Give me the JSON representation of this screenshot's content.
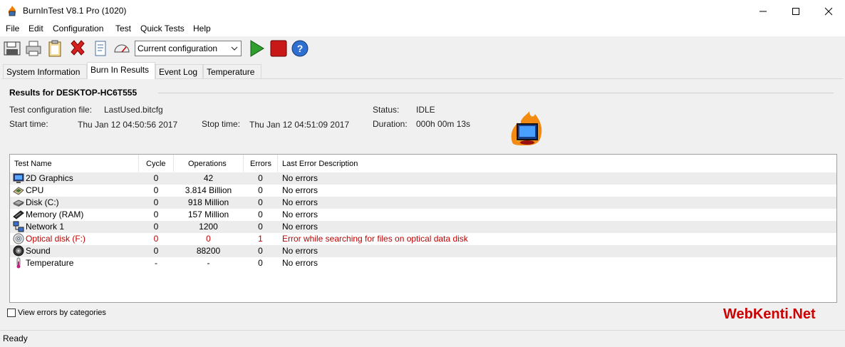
{
  "window": {
    "title": "BurnInTest V8.1 Pro (1020)"
  },
  "menu": [
    "File",
    "Edit",
    "Configuration",
    "Test",
    "Quick Tests",
    "Help"
  ],
  "toolbar": {
    "config_select": "Current configuration",
    "buttons": [
      "save-icon",
      "printer-icon",
      "clipboard-icon",
      "clear-results-icon",
      "test-preferences-icon",
      "duty-cycle-gauge-icon",
      "start-test-icon",
      "stop-test-icon",
      "help-icon"
    ]
  },
  "tabs": [
    "System Information",
    "Burn In Results",
    "Event Log",
    "Temperature"
  ],
  "results": {
    "heading": "Results for DESKTOP-HC6T555",
    "config_label": "Test configuration file:",
    "config_value": "LastUsed.bitcfg",
    "start_label": "Start time:",
    "start_value": "Thu Jan 12 04:50:56 2017",
    "stop_label": "Stop time:",
    "stop_value": "Thu Jan 12 04:51:09 2017",
    "status_label": "Status:",
    "status_value": "IDLE",
    "duration_label": "Duration:",
    "duration_value": "000h 00m 13s"
  },
  "table": {
    "columns": [
      "Test Name",
      "Cycle",
      "Operations",
      "Errors",
      "Last Error Description"
    ],
    "rows": [
      {
        "name": "2D Graphics",
        "cycle": "0",
        "ops": "42",
        "errors": "0",
        "desc": "No errors",
        "icon": "monitor-icon"
      },
      {
        "name": "CPU",
        "cycle": "0",
        "ops": "3.814 Billion",
        "errors": "0",
        "desc": "No errors",
        "icon": "cpu-icon"
      },
      {
        "name": "Disk (C:)",
        "cycle": "0",
        "ops": "918 Million",
        "errors": "0",
        "desc": "No errors",
        "icon": "disk-icon"
      },
      {
        "name": "Memory (RAM)",
        "cycle": "0",
        "ops": "157 Million",
        "errors": "0",
        "desc": "No errors",
        "icon": "memory-icon"
      },
      {
        "name": "Network 1",
        "cycle": "0",
        "ops": "1200",
        "errors": "0",
        "desc": "No errors",
        "icon": "network-icon"
      },
      {
        "name": "Optical disk (F:)",
        "cycle": "0",
        "ops": "0",
        "errors": "1",
        "desc": "Error while searching for files on optical data disk",
        "icon": "optical-disk-icon"
      },
      {
        "name": "Sound",
        "cycle": "0",
        "ops": "88200",
        "errors": "0",
        "desc": "No errors",
        "icon": "speaker-icon"
      },
      {
        "name": "Temperature",
        "cycle": "-",
        "ops": "-",
        "errors": "0",
        "desc": "No errors",
        "icon": "thermometer-icon"
      }
    ]
  },
  "options": {
    "view_errors_by_categories": "View errors by categories"
  },
  "watermark": "WebKenti.Net",
  "status_bar": "Ready",
  "colors": {
    "error_text": "#c00000",
    "start_green": "#2e9e2e",
    "stop_red": "#c81818",
    "watermark_red": "#cc0000"
  }
}
